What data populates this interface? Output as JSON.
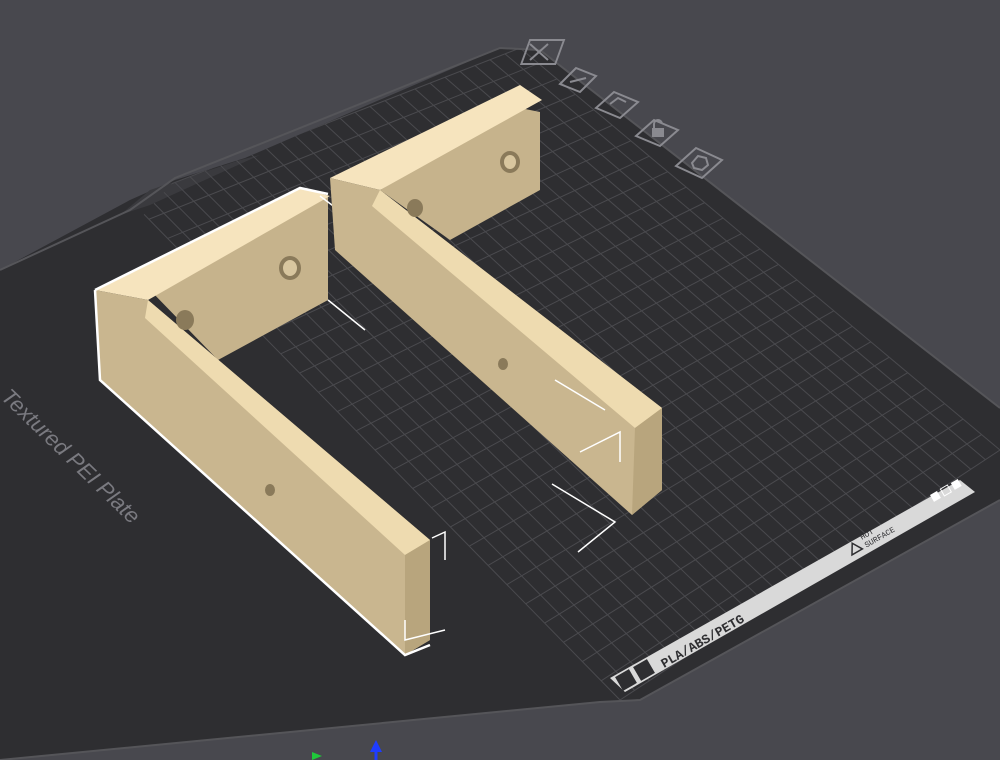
{
  "plate": {
    "name_label": "Textured PEI Plate",
    "material_label": "PLA/ABS/PETG",
    "warning_line1": "HOT",
    "warning_line2": "SURFACE"
  },
  "toolbar": {
    "items": [
      {
        "icon": "close-icon"
      },
      {
        "icon": "arrange-icon"
      },
      {
        "icon": "auto-orient-icon"
      },
      {
        "icon": "lock-icon"
      },
      {
        "icon": "settings-icon"
      }
    ]
  },
  "colors": {
    "background": "#48484e",
    "plate": "#2e2e31",
    "grid": "#4a4a4e",
    "model_face": "#c9b68f",
    "model_top": "#f3dfb6",
    "selection": "#ffffff",
    "axis_z": "#1e3cff",
    "axis_y": "#1fc83a"
  }
}
